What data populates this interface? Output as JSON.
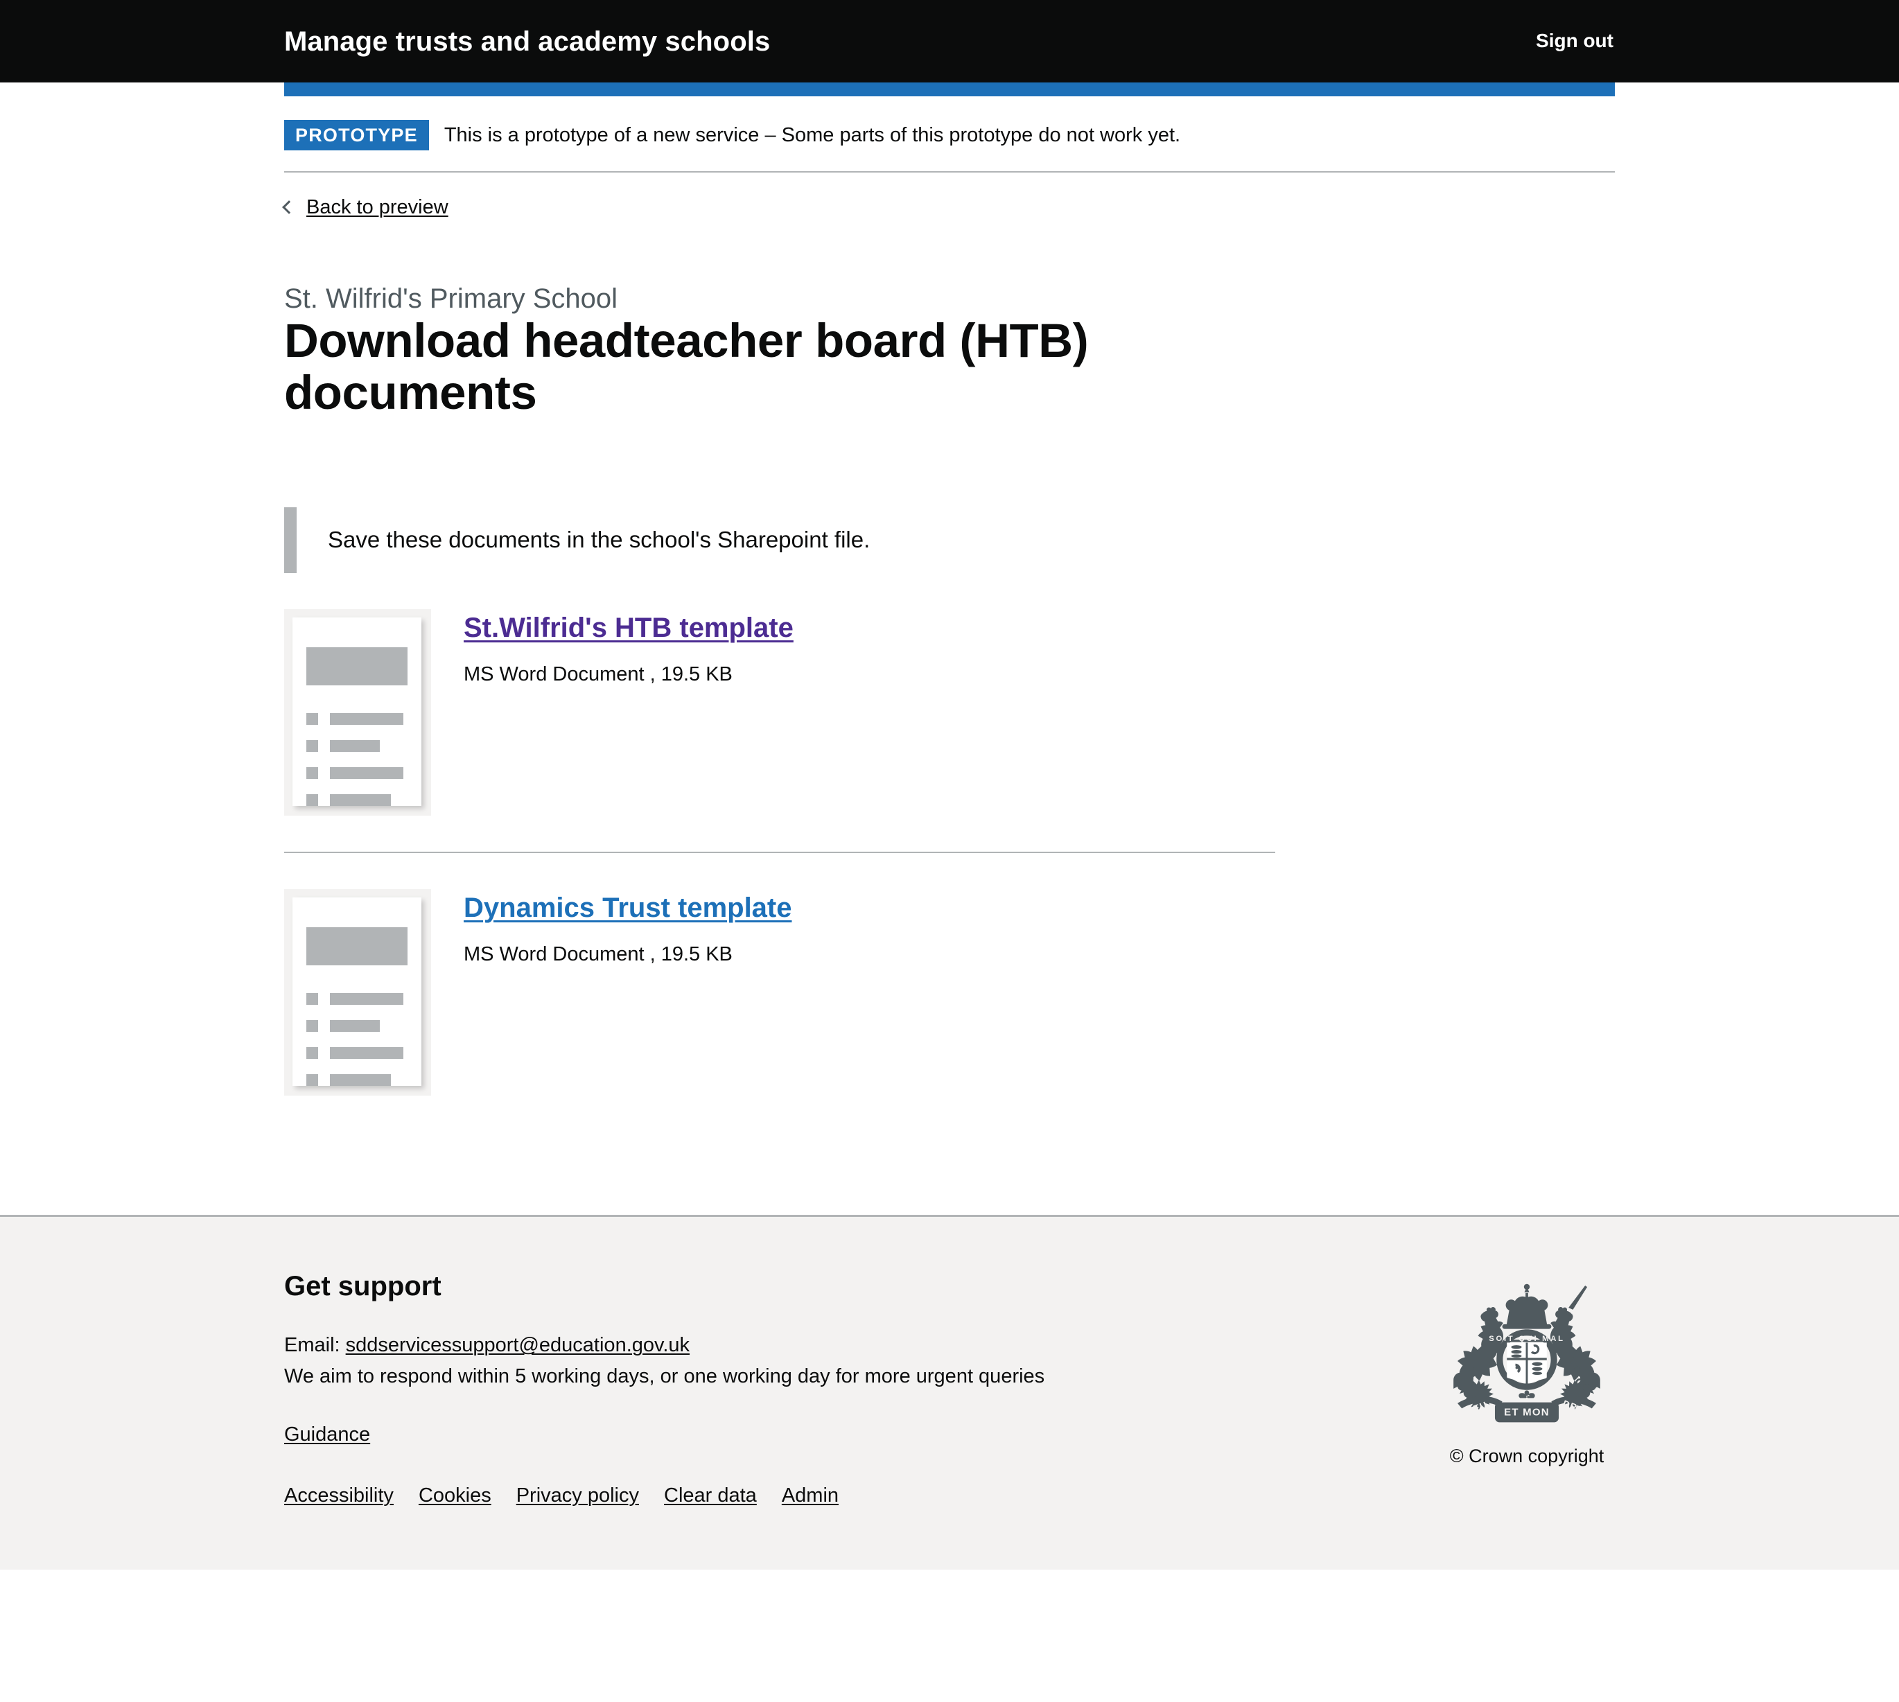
{
  "header": {
    "service_name": "Manage trusts and academy schools",
    "sign_out_label": "Sign out"
  },
  "phase_banner": {
    "tag": "PROTOTYPE",
    "text": "This is a prototype of a new service – Some parts of this prototype do not work yet."
  },
  "back_link": {
    "label": "Back to preview",
    "icon": "chevron-left-icon"
  },
  "main": {
    "caption": "St. Wilfrid's Primary School",
    "heading": "Download headteacher board (HTB) documents",
    "inset_text": "Save these documents in the school's Sharepoint file.",
    "documents": [
      {
        "link_label": "St.Wilfrid's HTB template",
        "meta": "MS Word Document , 19.5 KB",
        "link_state": "visited",
        "link_color": "#4c2c92",
        "thumbnail": "document-thumbnail-icon"
      },
      {
        "link_label": "Dynamics Trust template",
        "meta": "MS Word Document , 19.5 KB",
        "link_state": "unvisited",
        "link_color": "#1d70b8",
        "thumbnail": "document-thumbnail-icon"
      }
    ]
  },
  "footer": {
    "heading": "Get support",
    "email_prefix": "Email:",
    "email": "sddservicessupport@education.gov.uk",
    "response_time": "We aim to respond within 5 working days, or one working day for more urgent queries",
    "guidance_label": "Guidance",
    "nav": [
      {
        "label": "Accessibility"
      },
      {
        "label": "Cookies"
      },
      {
        "label": "Privacy policy"
      },
      {
        "label": "Clear data"
      },
      {
        "label": "Admin"
      }
    ],
    "copyright": "© Crown copyright",
    "crest_icon": "royal-coat-of-arms-icon"
  },
  "colors": {
    "black": "#0b0c0c",
    "blue": "#1d70b8",
    "visited_purple": "#4c2c92",
    "grey_border": "#b1b4b6",
    "grey_text": "#505a5f",
    "footer_bg": "#f3f2f1"
  }
}
